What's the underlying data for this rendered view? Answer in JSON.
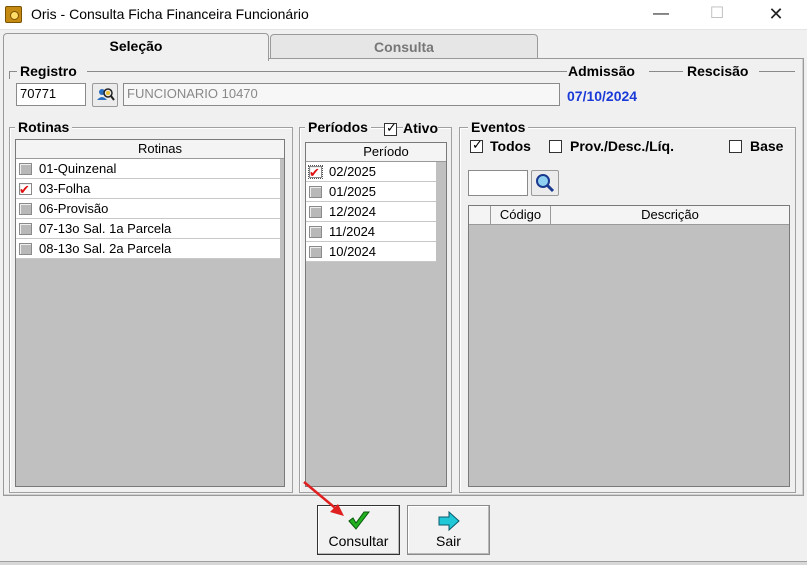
{
  "window": {
    "title": "Oris - Consulta Ficha Financeira Funcionário",
    "minimize": "—",
    "maximize": "☐",
    "close": "✕"
  },
  "tabs": [
    {
      "label": "Seleção",
      "active": true
    },
    {
      "label": "Consulta",
      "active": false
    }
  ],
  "registro": {
    "group_title": "Registro",
    "number": "70771",
    "employee_name": "FUNCIONARIO 10470",
    "lookup_icon": "search-people-icon"
  },
  "admissao": {
    "label": "Admissão",
    "date": "07/10/2024"
  },
  "rescisao": {
    "label": "Rescisão",
    "date": ""
  },
  "rotinas": {
    "group_title": "Rotinas",
    "column_header": "Rotinas",
    "items": [
      {
        "label": "01-Quinzenal",
        "checked": false
      },
      {
        "label": "03-Folha",
        "checked": true
      },
      {
        "label": "06-Provisão",
        "checked": false
      },
      {
        "label": "07-13o Sal. 1a Parcela",
        "checked": false
      },
      {
        "label": "08-13o Sal. 2a Parcela",
        "checked": false
      }
    ]
  },
  "periodos": {
    "group_title": "Períodos",
    "ativo_label": "Ativo",
    "ativo_checked": true,
    "column_header": "Período",
    "items": [
      {
        "label": "02/2025",
        "checked": true
      },
      {
        "label": "01/2025",
        "checked": false
      },
      {
        "label": "12/2024",
        "checked": false
      },
      {
        "label": "11/2024",
        "checked": false
      },
      {
        "label": "10/2024",
        "checked": false
      }
    ]
  },
  "eventos": {
    "group_title": "Eventos",
    "todos_label": "Todos",
    "todos_checked": true,
    "prov_label": "Prov./Desc./Líq.",
    "prov_checked": false,
    "base_label": "Base",
    "base_checked": false,
    "search_value": "",
    "columns": [
      "",
      "Código",
      "Descrição"
    ]
  },
  "buttons": {
    "consultar": "Consultar",
    "sair": "Sair"
  },
  "colors": {
    "accent_date": "#1a3ad8",
    "check_red": "#e01010",
    "check_green": "#20a020",
    "arrow_cyan": "#20c8d8"
  }
}
